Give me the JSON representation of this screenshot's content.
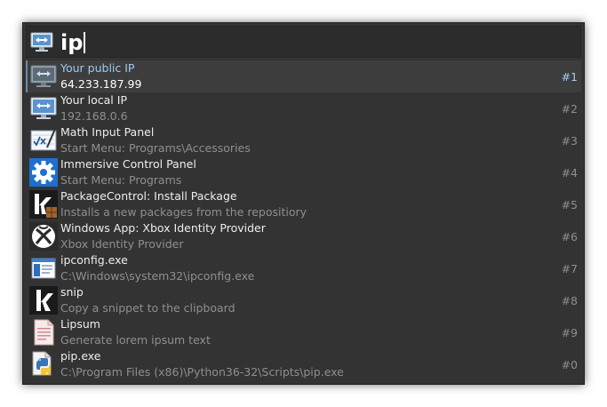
{
  "search": {
    "query": "ip",
    "icon": "network-monitor-icon"
  },
  "results": [
    {
      "title": "Your public IP",
      "subtitle": "64.233.187.99",
      "hotkey": "#1",
      "icon": "network-monitor-icon",
      "selected": true
    },
    {
      "title": "Your local IP",
      "subtitle": "192.168.0.6",
      "hotkey": "#2",
      "icon": "network-monitor-icon"
    },
    {
      "title": "Math Input Panel",
      "subtitle": "Start Menu: Programs\\Accessories",
      "hotkey": "#3",
      "icon": "math-input-panel-icon"
    },
    {
      "title": "Immersive Control Panel",
      "subtitle": "Start Menu: Programs",
      "hotkey": "#4",
      "icon": "gear-icon"
    },
    {
      "title": "PackageControl: Install Package",
      "subtitle": "Installs a new packages from the repositiory",
      "hotkey": "#5",
      "icon": "keypirinha-package-icon"
    },
    {
      "title": "Windows App: Xbox Identity Provider",
      "subtitle": "Xbox Identity Provider",
      "hotkey": "#6",
      "icon": "xbox-icon"
    },
    {
      "title": "ipconfig.exe",
      "subtitle": "C:\\Windows\\system32\\ipconfig.exe",
      "hotkey": "#7",
      "icon": "application-window-icon"
    },
    {
      "title": "snip",
      "subtitle": "Copy a snippet to the clipboard",
      "hotkey": "#8",
      "icon": "keypirinha-icon"
    },
    {
      "title": "Lipsum",
      "subtitle": "Generate lorem ipsum text",
      "hotkey": "#9",
      "icon": "document-icon"
    },
    {
      "title": "pip.exe",
      "subtitle": "C:\\Program Files (x86)\\Python36-32\\Scripts\\pip.exe",
      "hotkey": "#0",
      "icon": "python-file-icon"
    }
  ],
  "colors": {
    "window_bg": "#333333",
    "selected_row_bg": "#3d3d3d",
    "selected_text": "#9ecbf2",
    "dim_text": "#8f8f8f"
  }
}
